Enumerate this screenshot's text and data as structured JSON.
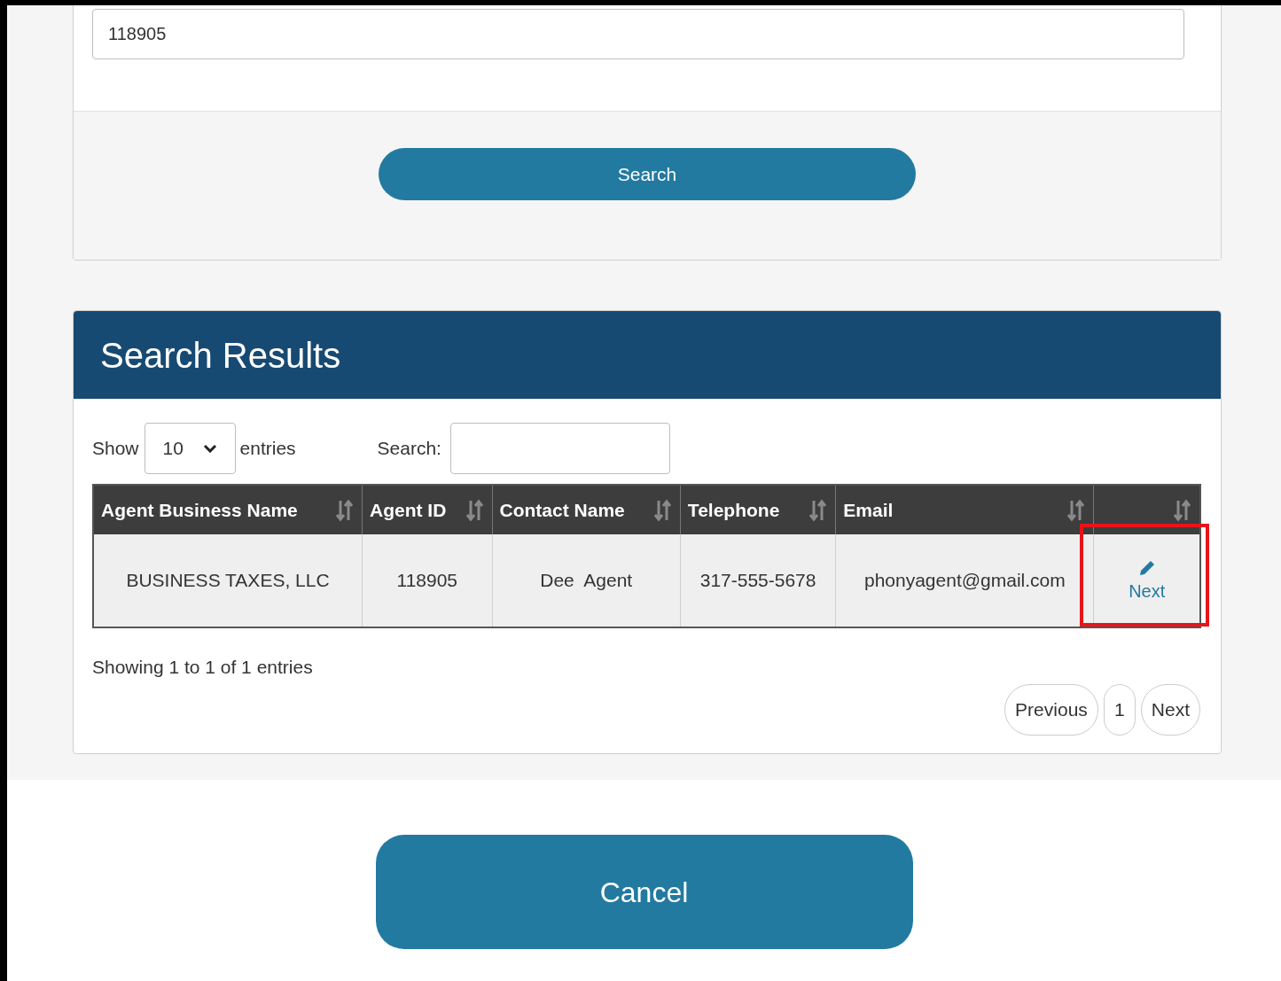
{
  "search_form": {
    "agent_id_value": "118905",
    "search_button": "Search"
  },
  "results": {
    "title": "Search Results",
    "length": {
      "show_label": "Show",
      "value": "10",
      "entries_label": "entries"
    },
    "filter": {
      "label": "Search:"
    },
    "columns": [
      "Agent Business Name",
      "Agent ID",
      "Contact Name",
      "Telephone",
      "Email",
      ""
    ],
    "rows": [
      {
        "cells": [
          "BUSINESS TAXES, LLC",
          "118905",
          "Dee  Agent",
          "317-555-5678",
          "phonyagent@gmail.com"
        ],
        "action": "Next",
        "highlighted": true
      }
    ],
    "info": "Showing 1 to 1 of 1 entries",
    "pagination": [
      {
        "label": "Previous",
        "selected": false
      },
      {
        "label": "1",
        "selected": false
      },
      {
        "label": "Next",
        "selected": false
      }
    ]
  },
  "cancel_button": "Cancel"
}
